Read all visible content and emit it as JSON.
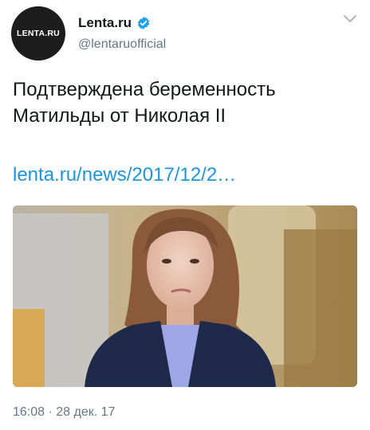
{
  "tweet": {
    "avatar_text": "LENTA.RU",
    "display_name": "Lenta.ru",
    "handle": "@lentaruofficial",
    "text": "Подтверждена беременность Матильды от Николая II",
    "link_text": "lenta.ru/news/2017/12/2…",
    "timestamp": "16:08 · 28 дек. 17"
  },
  "icons": {
    "verified": "verified-badge-icon",
    "menu": "chevron-down-icon"
  },
  "colors": {
    "link": "#1b95e0",
    "secondary_text": "#657786",
    "verified": "#1da1f2",
    "avatar_bg": "#1d1d1d"
  }
}
